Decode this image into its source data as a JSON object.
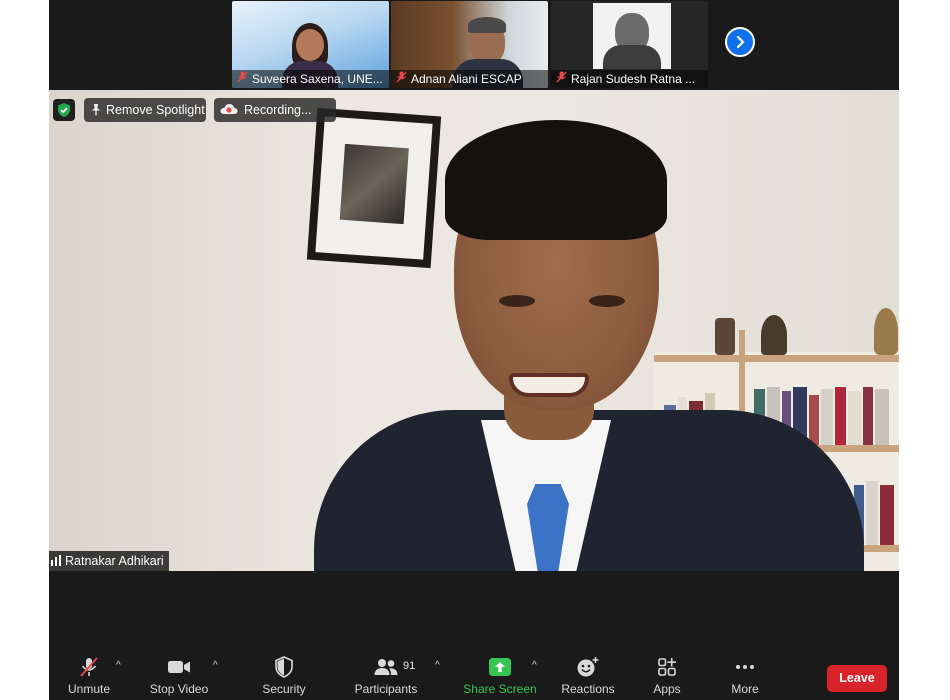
{
  "gallery": {
    "thumbnails": [
      {
        "name": "Suveera Saxena, UNE...",
        "muted": true
      },
      {
        "name": "Adnan Aliani ESCAP",
        "muted": true
      },
      {
        "name": "Rajan Sudesh Ratna ...",
        "muted": true
      }
    ]
  },
  "overlay": {
    "spotlight_label": "Remove Spotlight",
    "recording_label": "Recording..."
  },
  "active_speaker": {
    "name": "Ratnakar Adhikari"
  },
  "toolbar": {
    "unmute": "Unmute",
    "stop_video": "Stop Video",
    "security": "Security",
    "participants": "Participants",
    "participant_count": "91",
    "share_screen": "Share Screen",
    "reactions": "Reactions",
    "apps": "Apps",
    "more": "More",
    "leave": "Leave"
  },
  "colors": {
    "leave": "#d8232a",
    "share": "#37c653",
    "accent": "#0e71eb",
    "shield": "#1fa84a"
  }
}
